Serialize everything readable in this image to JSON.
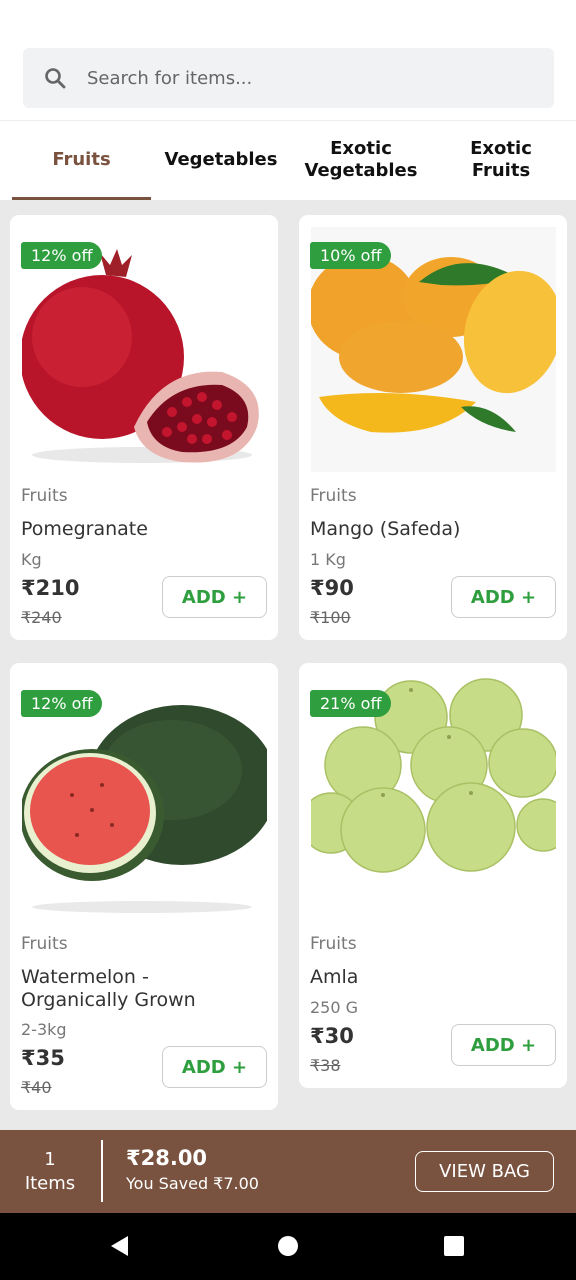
{
  "search": {
    "placeholder": "Search for items..."
  },
  "tabs": [
    {
      "label": "Fruits",
      "active": true
    },
    {
      "label": "Vegetables",
      "active": false
    },
    {
      "label": "Exotic Vegetables",
      "active": false
    },
    {
      "label": "Exotic Fruits",
      "active": false
    }
  ],
  "products": [
    {
      "discount": "12% off",
      "category": "Fruits",
      "name": "Pomegranate",
      "unit": "Kg",
      "price": "₹210",
      "mrp": "₹240",
      "add_label": "ADD +"
    },
    {
      "discount": "10% off",
      "category": "Fruits",
      "name": "Mango (Safeda)",
      "unit": "1 Kg",
      "price": "₹90",
      "mrp": "₹100",
      "add_label": "ADD +"
    },
    {
      "discount": "12% off",
      "category": "Fruits",
      "name": "Watermelon - Organically Grown",
      "unit": "2-3kg",
      "price": "₹35",
      "mrp": "₹40",
      "add_label": "ADD +"
    },
    {
      "discount": "21% off",
      "category": "Fruits",
      "name": "Amla",
      "unit": "250 G",
      "price": "₹30",
      "mrp": "₹38",
      "add_label": "ADD +"
    }
  ],
  "cart": {
    "count": "1",
    "count_label": "Items",
    "total": "₹28.00",
    "saved": "You Saved ₹7.00",
    "view_bag_label": "VIEW BAG"
  },
  "colors": {
    "brand": "#7a5340",
    "discount": "#2e9e3e",
    "add": "#2e9e3e"
  },
  "icons": [
    "search-icon",
    "back-icon",
    "home-icon",
    "recents-icon"
  ]
}
